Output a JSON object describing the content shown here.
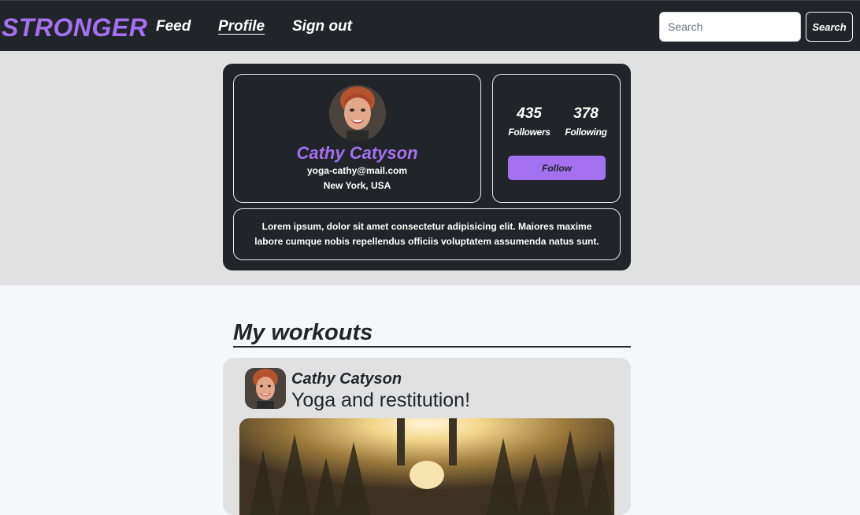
{
  "navbar": {
    "brand": "STRONGER",
    "links": {
      "feed": "Feed",
      "profile": "Profile",
      "signout": "Sign out"
    },
    "search": {
      "placeholder": "Search",
      "button_label": "Search"
    }
  },
  "profile": {
    "name": "Cathy Catyson",
    "email": "yoga-cathy@mail.com",
    "location": "New York, USA",
    "followers_count": "435",
    "followers_label": "Followers",
    "following_count": "378",
    "following_label": "Following",
    "follow_label": "Follow",
    "bio": "Lorem ipsum, dolor sit amet consectetur adipisicing elit. Maiores maxime labore cumque nobis repellendus officiis voluptatem assumenda natus sunt."
  },
  "workouts": {
    "title": "My workouts",
    "posts": [
      {
        "author": "Cathy Catyson",
        "title": "Yoga and restitution!"
      }
    ]
  },
  "colors": {
    "accent": "#a371f0",
    "dark": "#212529",
    "band": "#e1e1e1"
  }
}
